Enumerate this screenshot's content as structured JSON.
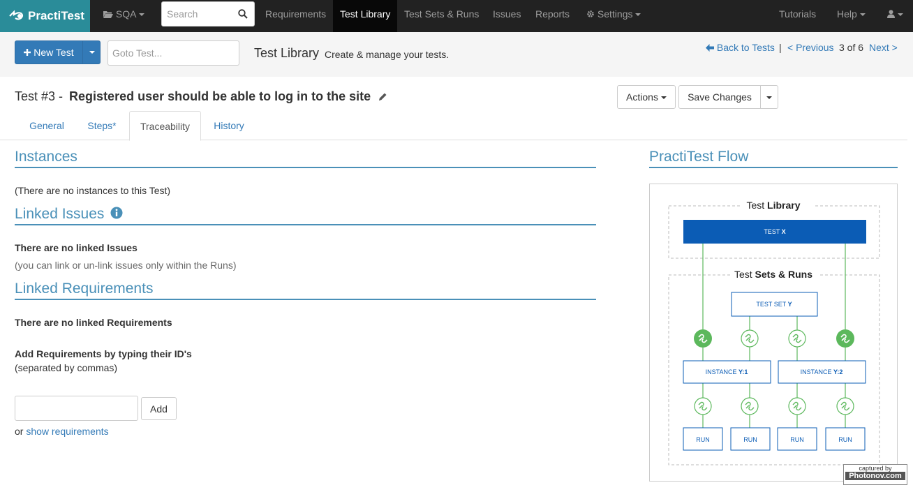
{
  "nav": {
    "logo": "PractiTest",
    "project": "SQA",
    "search_placeholder": "Search",
    "items": [
      "Requirements",
      "Test Library",
      "Test Sets & Runs",
      "Issues",
      "Reports"
    ],
    "settings": "Settings",
    "tutorials": "Tutorials",
    "help": "Help"
  },
  "subbar": {
    "new_test": "New Test",
    "goto_placeholder": "Goto Test...",
    "title": "Test Library",
    "subtitle": "Create & manage your tests.",
    "back": "Back to Tests",
    "sep": "|",
    "previous": "< Previous",
    "count": "3 of 6",
    "next": "Next >"
  },
  "test": {
    "id": "Test #3 -",
    "name": "Registered user should be able to log in to the site",
    "actions": "Actions",
    "save": "Save Changes"
  },
  "tabs": [
    "General",
    "Steps*",
    "Traceability",
    "History"
  ],
  "instances": {
    "heading": "Instances",
    "empty": "(There are no instances to this Test)"
  },
  "issues": {
    "heading": "Linked Issues",
    "empty": "There are no linked Issues",
    "note": "(you can link or un-link issues only within the Runs)"
  },
  "requirements": {
    "heading": "Linked Requirements",
    "empty": "There are no linked Requirements",
    "add_title": "Add Requirements by typing their ID's",
    "add_note": "(separated by commas)",
    "add_button": "Add",
    "or": "or",
    "show": "show requirements"
  },
  "flow": {
    "heading": "PractiTest Flow",
    "lib_label_1": "Test",
    "lib_label_2": "Library",
    "test_x_1": "TEST",
    "test_x_2": "X",
    "sets_label_1": "Test",
    "sets_label_2": "Sets & Runs",
    "test_set_1": "TEST SET",
    "test_set_2": "Y",
    "instance1_1": "INSTANCE",
    "instance1_2": "Y:1",
    "instance2_1": "INSTANCE",
    "instance2_2": "Y:2",
    "run": "RUN"
  },
  "capture": {
    "line1": "captured by",
    "line2": "Photonov.com"
  },
  "colors": {
    "nav_bg": "#222222",
    "logo_bg": "#2a8c99",
    "primary": "#337ab7",
    "heading": "#4a90b8",
    "flow_blue": "#0b5cb5",
    "flow_green": "#5cb85c"
  }
}
